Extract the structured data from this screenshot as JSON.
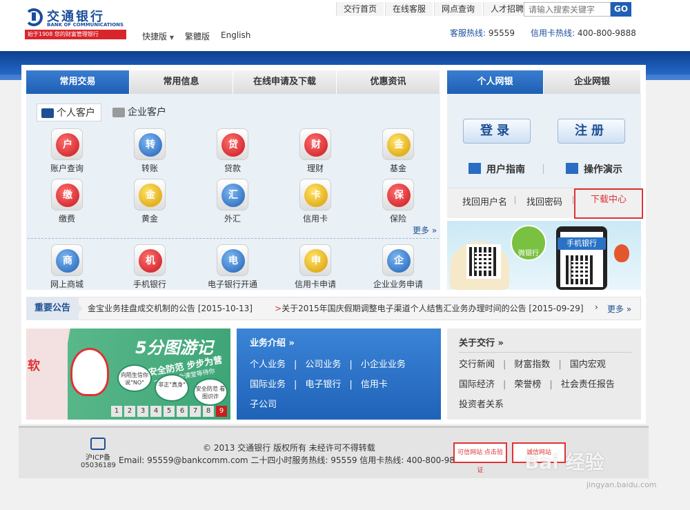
{
  "brand": {
    "name_cn": "交通银行",
    "name_en": "BANK OF COMMUNICATIONS",
    "slogan": "始于1908 您的财富管理银行"
  },
  "lang_links": [
    "快捷版",
    "繁體版",
    "English"
  ],
  "top_nav": [
    "交行首页",
    "在线客服",
    "网点查询",
    "人才招聘"
  ],
  "search": {
    "placeholder": "请输入搜索关键字",
    "go_label": "GO"
  },
  "hotlines": {
    "service_label": "客服热线:",
    "service_number": "95559",
    "card_label": "信用卡热线:",
    "card_number": "400-800-9888"
  },
  "main_tabs": [
    "常用交易",
    "常用信息",
    "在线申请及下载",
    "优惠资讯"
  ],
  "customer_tabs": [
    "个人客户",
    "企业客户"
  ],
  "services_row1": [
    "账户查询",
    "转账",
    "贷款",
    "理财",
    "基金"
  ],
  "services_row2": [
    "缴费",
    "黄金",
    "外汇",
    "信用卡",
    "保险"
  ],
  "services_row3": [
    "网上商城",
    "手机银行",
    "电子银行开通",
    "信用卡申请",
    "企业业务申请"
  ],
  "service_glyphs": [
    "户",
    "转",
    "贷",
    "财",
    "金",
    "缴",
    "金",
    "汇",
    "卡",
    "保",
    "商",
    "机",
    "电",
    "申",
    "企"
  ],
  "more_label": "更多 »",
  "ebank_tabs": [
    "个人网银",
    "企业网银"
  ],
  "login_label": "登录",
  "register_label": "注册",
  "user_guide": "用户指南",
  "demo": "操作演示",
  "find_links": [
    "找回用户名",
    "找回密码"
  ],
  "download_center": "下载中心",
  "banner": {
    "wechat": "微银行",
    "mobile": "手机银行"
  },
  "notice": {
    "title": "重要公告",
    "items": [
      "金宝业务挂盘成交机制的公告 [2015-10-13]",
      "关于2015年国庆假期调整电子渠道个人结售汇业务办理时间的公告 [2015-09-29]"
    ],
    "arrow": ">",
    "more": "更多 »"
  },
  "promo": {
    "title": "5分图游记",
    "sub1": "安全防范 步步为营",
    "sub2": "一行行安全课堂等待你",
    "left_text": "软",
    "bubbles": [
      "向陌生信你说\"NO\"",
      "非正\"真身\"",
      "安全防范 看图识诈"
    ],
    "pages": [
      "1",
      "2",
      "3",
      "4",
      "5",
      "6",
      "7",
      "8",
      "9"
    ],
    "active_page": "9"
  },
  "biz": {
    "title": "业务介绍 »",
    "rows": [
      [
        "个人业务",
        "公司业务",
        "小企业业务"
      ],
      [
        "国际业务",
        "电子银行",
        "信用卡"
      ],
      [
        "子公司"
      ]
    ]
  },
  "about": {
    "title": "关于交行 »",
    "rows": [
      [
        "交行新闻",
        "财富指数",
        "国内宏观"
      ],
      [
        "国际经济",
        "荣誉榜",
        "社会责任报告"
      ],
      [
        "投资者关系"
      ]
    ]
  },
  "footer": {
    "icp": "沪ICP备05036189",
    "copyright": "© 2013 交通银行  版权所有  未经许可不得转载",
    "contact": "Email: 95559@bankcomm.com  二十四小时服务热线: 95559  信用卡热线: 400-800-9888",
    "badge1": "可信网站 点击验证",
    "badge2": "诚信网站"
  },
  "watermark": {
    "text": "Bai 经验",
    "url": "jingyan.baidu.com"
  },
  "colors": {
    "brand_blue": "#1d4f93",
    "accent_red": "#d33",
    "tab_active": "#1d5fb4"
  }
}
